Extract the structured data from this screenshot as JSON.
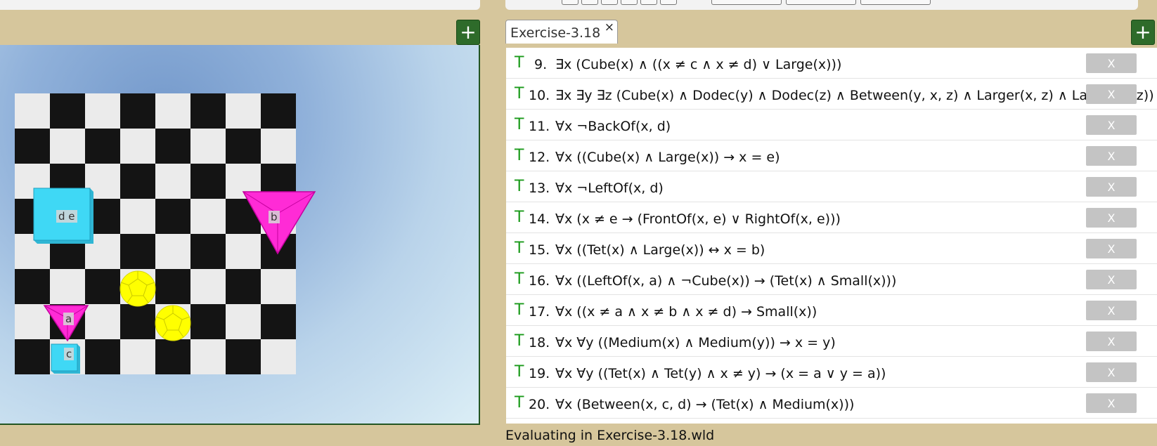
{
  "toolbar": {
    "add_world_label": "+",
    "add_sentence_label": "+"
  },
  "world": {
    "objects": [
      {
        "label": "d e",
        "shape": "cube",
        "size": "large",
        "color": "#3fd8f5"
      },
      {
        "label": "b",
        "shape": "tetrahedron",
        "size": "large",
        "color": "#ff2bd6"
      },
      {
        "label": "a",
        "shape": "tetrahedron",
        "size": "small",
        "color": "#ff2bd6"
      },
      {
        "label": "c",
        "shape": "cube",
        "size": "small",
        "color": "#3fd8f5"
      },
      {
        "label": "",
        "shape": "dodecahedron",
        "size": "small",
        "color": "#ffff00"
      },
      {
        "label": "",
        "shape": "dodecahedron",
        "size": "small",
        "color": "#ffff00"
      }
    ]
  },
  "tab": {
    "label": "Exercise-3.18",
    "close": "×"
  },
  "sentences": [
    {
      "truth": "T",
      "num": "9.",
      "text": "∃x (Cube(x) ∧ ((x ≠ c ∧ x ≠ d) ∨ Large(x)))",
      "delete": "X"
    },
    {
      "truth": "T",
      "num": "10.",
      "text": "∃x ∃y ∃z (Cube(x) ∧ Dodec(y) ∧ Dodec(z) ∧ Between(y, x, z)  ∧ Larger(x, z) ∧ Larger(x, z))",
      "delete": "X"
    },
    {
      "truth": "T",
      "num": "11.",
      "text": "∀x ¬BackOf(x, d)",
      "delete": "X"
    },
    {
      "truth": "T",
      "num": "12.",
      "text": "∀x ((Cube(x) ∧ Large(x)) → x = e)",
      "delete": "X"
    },
    {
      "truth": "T",
      "num": "13.",
      "text": "∀x ¬LeftOf(x, d)",
      "delete": "X"
    },
    {
      "truth": "T",
      "num": "14.",
      "text": "∀x (x ≠ e → (FrontOf(x, e) ∨ RightOf(x, e)))",
      "delete": "X"
    },
    {
      "truth": "T",
      "num": "15.",
      "text": "∀x ((Tet(x) ∧ Large(x)) ↔ x = b)",
      "delete": "X"
    },
    {
      "truth": "T",
      "num": "16.",
      "text": "∀x ((LeftOf(x, a) ∧ ¬Cube(x)) → (Tet(x) ∧ Small(x)))",
      "delete": "X"
    },
    {
      "truth": "T",
      "num": "17.",
      "text": "∀x ((x ≠ a ∧ x ≠ b  ∧ x ≠ d) → Small(x))",
      "delete": "X"
    },
    {
      "truth": "T",
      "num": "18.",
      "text": "∀x ∀y ((Medium(x) ∧ Medium(y)) → x = y)",
      "delete": "X"
    },
    {
      "truth": "T",
      "num": "19.",
      "text": "∀x ∀y ((Tet(x) ∧ Tet(y) ∧ x ≠ y) → (x = a ∨ y = a))",
      "delete": "X"
    },
    {
      "truth": "T",
      "num": "20.",
      "text": "∀x (Between(x, c, d) → (Tet(x) ∧ Medium(x)))",
      "delete": "X"
    }
  ],
  "status": "Evaluating in Exercise-3.18.wld",
  "colors": {
    "true": "#1a9a1a",
    "accent": "#2e6b2a",
    "background": "#d6c69c"
  }
}
